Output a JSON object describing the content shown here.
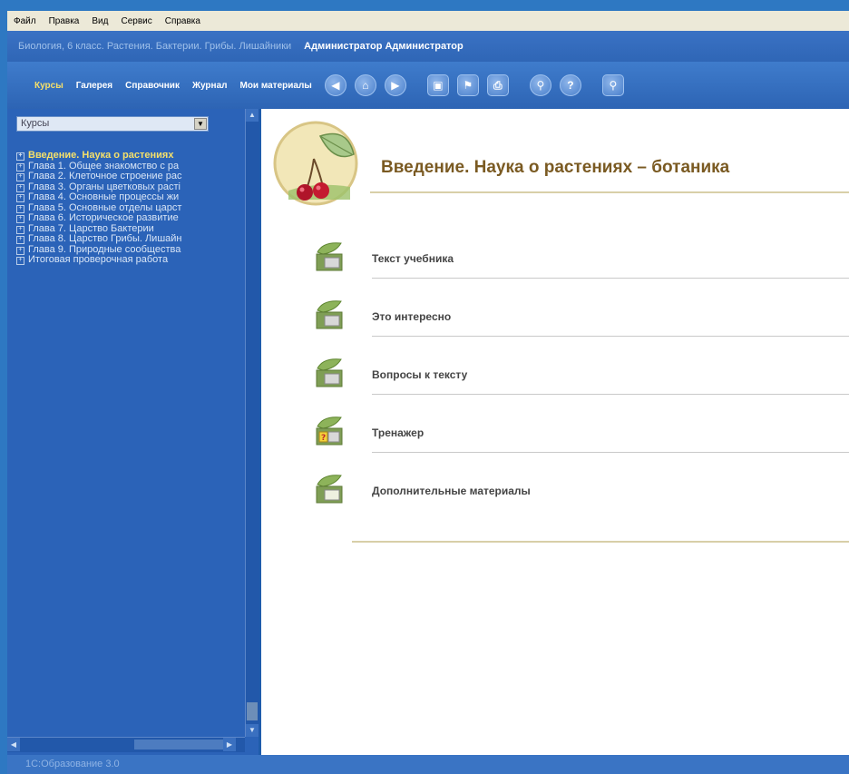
{
  "menu": [
    "Файл",
    "Правка",
    "Вид",
    "Сервис",
    "Справка"
  ],
  "title": {
    "course": "Биология, 6 класс. Растения. Бактерии. Грибы. Лишайники",
    "user": "Администратор Администратор"
  },
  "toolbar": {
    "nav": [
      "Курсы",
      "Галерея",
      "Справочник",
      "Журнал",
      "Мои материалы"
    ],
    "active_nav": "Курсы",
    "icons": [
      "back-icon",
      "home-icon",
      "forward-icon",
      "fullscreen-icon",
      "bookmark-icon",
      "print-icon",
      "search-icon",
      "help-icon",
      "zoom-icon"
    ]
  },
  "sidebar": {
    "select_value": "Курсы",
    "tree": [
      "Введение. Наука о растениях",
      "Глава 1. Общее знакомство с ра",
      "Глава 2. Клеточное строение рас",
      "Глава 3. Органы цветковых расті",
      "Глава 4. Основные процессы жи",
      "Глава 5. Основные отделы царст",
      "Глава 6. Историческое развитие",
      "Глава 7. Царство Бактерии",
      "Глава 8. Царство Грибы. Лишайн",
      "Глава 9. Природные сообщества",
      "Итоговая проверочная работа"
    ]
  },
  "main": {
    "title": "Введение. Наука о растениях – ботаника",
    "items": [
      "Текст учебника",
      "Это интересно",
      "Вопросы к тексту",
      "Тренажер",
      "Дополнительные материалы"
    ]
  },
  "status": "1С:Образование 3.0",
  "colors": {
    "frame": "#1f5cab",
    "title_text": "#7a5a22",
    "selected_tree": "#f5e06a",
    "content_bg": "#ffffff"
  }
}
